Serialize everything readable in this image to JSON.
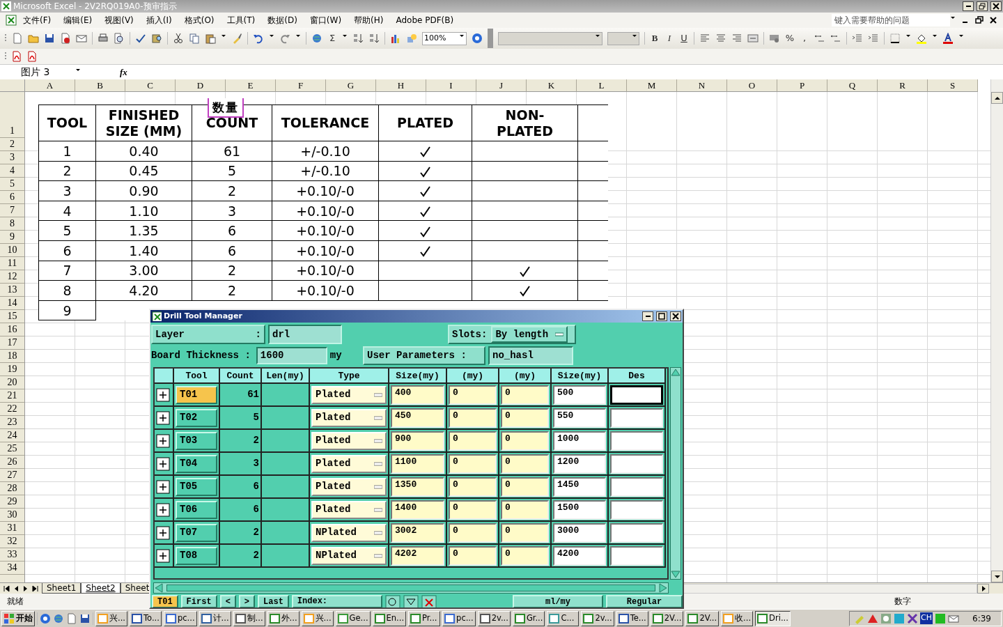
{
  "window": {
    "title": "Microsoft Excel - 2V2RQ019A0-预审指示"
  },
  "menu": [
    "文件(F)",
    "编辑(E)",
    "视图(V)",
    "插入(I)",
    "格式(O)",
    "工具(T)",
    "数据(D)",
    "窗口(W)",
    "帮助(H)",
    "Adobe PDF(B)"
  ],
  "help_box": {
    "placeholder": "键入需要帮助的问题"
  },
  "toolbar": {
    "sum": "Σ",
    "zoom": "100%",
    "bold": "B",
    "italic": "I",
    "underline": "U",
    "percent": "%",
    "comma": ","
  },
  "formula_bar": {
    "name_box": "图片 3",
    "fx": "fx"
  },
  "columns": [
    "A",
    "B",
    "C",
    "D",
    "E",
    "F",
    "G",
    "H",
    "I",
    "J",
    "K",
    "L",
    "M",
    "N",
    "O",
    "P",
    "Q",
    "R",
    "S"
  ],
  "rows": [
    "1",
    "2",
    "3",
    "4",
    "5",
    "6",
    "7",
    "8",
    "9",
    "10",
    "11",
    "12",
    "13",
    "14",
    "15",
    "16",
    "17",
    "18",
    "19",
    "20",
    "21",
    "22",
    "23",
    "24",
    "25",
    "26",
    "27",
    "28",
    "29",
    "30",
    "31",
    "32",
    "33",
    "34"
  ],
  "picture_table": {
    "callout": "数量",
    "columns": [
      "TOOL",
      "FINISHED SIZE (MM)",
      "COUNT",
      "TOLERANCE",
      "PLATED",
      "NON-PLATED"
    ],
    "rows": [
      {
        "tool": "1",
        "size": "0.40",
        "count": "61",
        "tolerance": "+/-0.10",
        "plated": true,
        "non_plated": false
      },
      {
        "tool": "2",
        "size": "0.45",
        "count": "5",
        "tolerance": "+/-0.10",
        "plated": true,
        "non_plated": false
      },
      {
        "tool": "3",
        "size": "0.90",
        "count": "2",
        "tolerance": "+0.10/-0",
        "plated": true,
        "non_plated": false
      },
      {
        "tool": "4",
        "size": "1.10",
        "count": "3",
        "tolerance": "+0.10/-0",
        "plated": true,
        "non_plated": false
      },
      {
        "tool": "5",
        "size": "1.35",
        "count": "6",
        "tolerance": "+0.10/-0",
        "plated": true,
        "non_plated": false
      },
      {
        "tool": "6",
        "size": "1.40",
        "count": "6",
        "tolerance": "+0.10/-0",
        "plated": true,
        "non_plated": false
      },
      {
        "tool": "7",
        "size": "3.00",
        "count": "2",
        "tolerance": "+0.10/-0",
        "plated": false,
        "non_plated": true
      },
      {
        "tool": "8",
        "size": "4.20",
        "count": "2",
        "tolerance": "+0.10/-0",
        "plated": false,
        "non_plated": true
      },
      {
        "tool": "9"
      }
    ]
  },
  "sheet_tabs": [
    {
      "label": "Sheet1",
      "selected": false
    },
    {
      "label": "Sheet2",
      "selected": true
    },
    {
      "label": "Sheet",
      "selected": false
    }
  ],
  "status_bar": {
    "ready": "就绪",
    "num_lock": "数字"
  },
  "dialog": {
    "title": "Drill Tool Manager",
    "layer_label": "Layer",
    "layer_colon": ":",
    "layer_value": "drl",
    "slots_label": "Slots:",
    "slots_value": "By length",
    "thickness_label": "Board Thickness :",
    "thickness_value": "1600",
    "thickness_unit": "my",
    "user_params_label": "User Parameters :",
    "user_params_value": "no_hasl",
    "grid_headers": [
      "Tool",
      "Count",
      "Len(my)",
      "Type",
      "Size(my)",
      "(my)",
      "(my)",
      "Size(my)",
      "Des"
    ],
    "tools": [
      {
        "tool": "T01",
        "selected": true,
        "count": "61",
        "type": "Plated",
        "size": "400",
        "col_6": "0",
        "col_7": "0",
        "finished": "500",
        "focused": true
      },
      {
        "tool": "T02",
        "selected": false,
        "count": "5",
        "type": "Plated",
        "size": "450",
        "col_6": "0",
        "col_7": "0",
        "finished": "550",
        "focused": false
      },
      {
        "tool": "T03",
        "selected": false,
        "count": "2",
        "type": "Plated",
        "size": "900",
        "col_6": "0",
        "col_7": "0",
        "finished": "1000",
        "focused": false
      },
      {
        "tool": "T04",
        "selected": false,
        "count": "3",
        "type": "Plated",
        "size": "1100",
        "col_6": "0",
        "col_7": "0",
        "finished": "1200",
        "focused": false
      },
      {
        "tool": "T05",
        "selected": false,
        "count": "6",
        "type": "Plated",
        "size": "1350",
        "col_6": "0",
        "col_7": "0",
        "finished": "1450",
        "focused": false
      },
      {
        "tool": "T06",
        "selected": false,
        "count": "6",
        "type": "Plated",
        "size": "1400",
        "col_6": "0",
        "col_7": "0",
        "finished": "1500",
        "focused": false
      },
      {
        "tool": "T07",
        "selected": false,
        "count": "2",
        "type": "NPlated",
        "size": "3002",
        "col_6": "0",
        "col_7": "0",
        "finished": "3000",
        "focused": false
      },
      {
        "tool": "T08",
        "selected": false,
        "count": "2",
        "type": "NPlated",
        "size": "4202",
        "col_6": "0",
        "col_7": "0",
        "finished": "4200",
        "focused": false
      }
    ],
    "bottom_buttons": [
      "T01",
      "First",
      "<",
      ">",
      "Last"
    ],
    "index_label": "Index:",
    "unit_menu": "ml/my",
    "mode_menu": "Regular"
  },
  "taskbar": {
    "start": "开始",
    "tasks": [
      {
        "label": "兴...",
        "selected": false
      },
      {
        "label": "To...",
        "selected": false
      },
      {
        "label": "pc...",
        "selected": false
      },
      {
        "label": "计...",
        "selected": false
      },
      {
        "label": "制...",
        "selected": false
      },
      {
        "label": "外...",
        "selected": false
      },
      {
        "label": "兴...",
        "selected": false
      },
      {
        "label": "Ge...",
        "selected": false
      },
      {
        "label": "En...",
        "selected": false
      },
      {
        "label": "Pr...",
        "selected": false
      },
      {
        "label": "pc...",
        "selected": false
      },
      {
        "label": "2v...",
        "selected": false
      },
      {
        "label": "Gr...",
        "selected": false
      },
      {
        "label": "C...",
        "selected": false
      },
      {
        "label": "2v...",
        "selected": false
      },
      {
        "label": "Te...",
        "selected": false
      },
      {
        "label": "2V...",
        "selected": false
      },
      {
        "label": "2V...",
        "selected": false
      },
      {
        "label": "收...",
        "selected": false
      },
      {
        "label": "Dri...",
        "selected": true
      }
    ],
    "tray_lang": "CH",
    "clock": "6:39"
  }
}
